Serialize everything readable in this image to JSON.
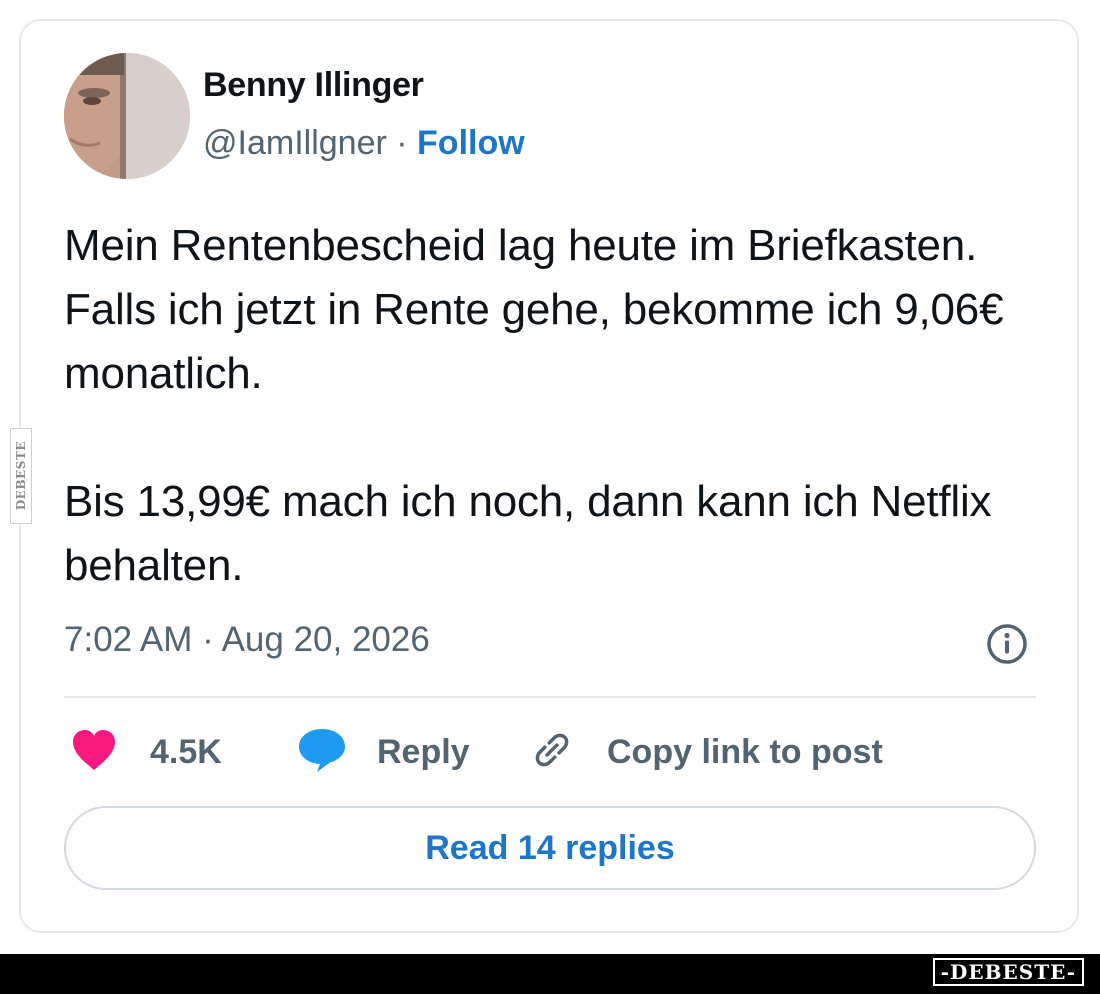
{
  "author": {
    "name": "Benny Illinger",
    "handle": "@IamIllgner",
    "separator": "·",
    "follow_label": "Follow"
  },
  "tweet": {
    "paragraph1": "Mein Rentenbescheid lag heute im Briefkasten. Falls ich jetzt in Rente gehe, bekomme ich 9,06€ monatlich.",
    "paragraph2": "Bis 13,99€ mach ich noch, dann kann ich Netflix behalten.",
    "timestamp": "7:02 AM · Aug 20, 2026"
  },
  "actions": {
    "like_count": "4.5K",
    "reply_label": "Reply",
    "copy_link_label": "Copy link to post"
  },
  "read_replies_label": "Read 14 replies",
  "watermark": {
    "side_text": "DEBESTE",
    "logo_text": "-DEBESTE-"
  },
  "colors": {
    "follow_blue": "#1d76c8",
    "like_pink": "#f91880",
    "reply_blue": "#1d9bf0",
    "secondary_text": "#536471",
    "primary_text": "#0f1419"
  },
  "icons": [
    "info-icon",
    "heart-icon",
    "speech-bubble-icon",
    "link-icon"
  ]
}
